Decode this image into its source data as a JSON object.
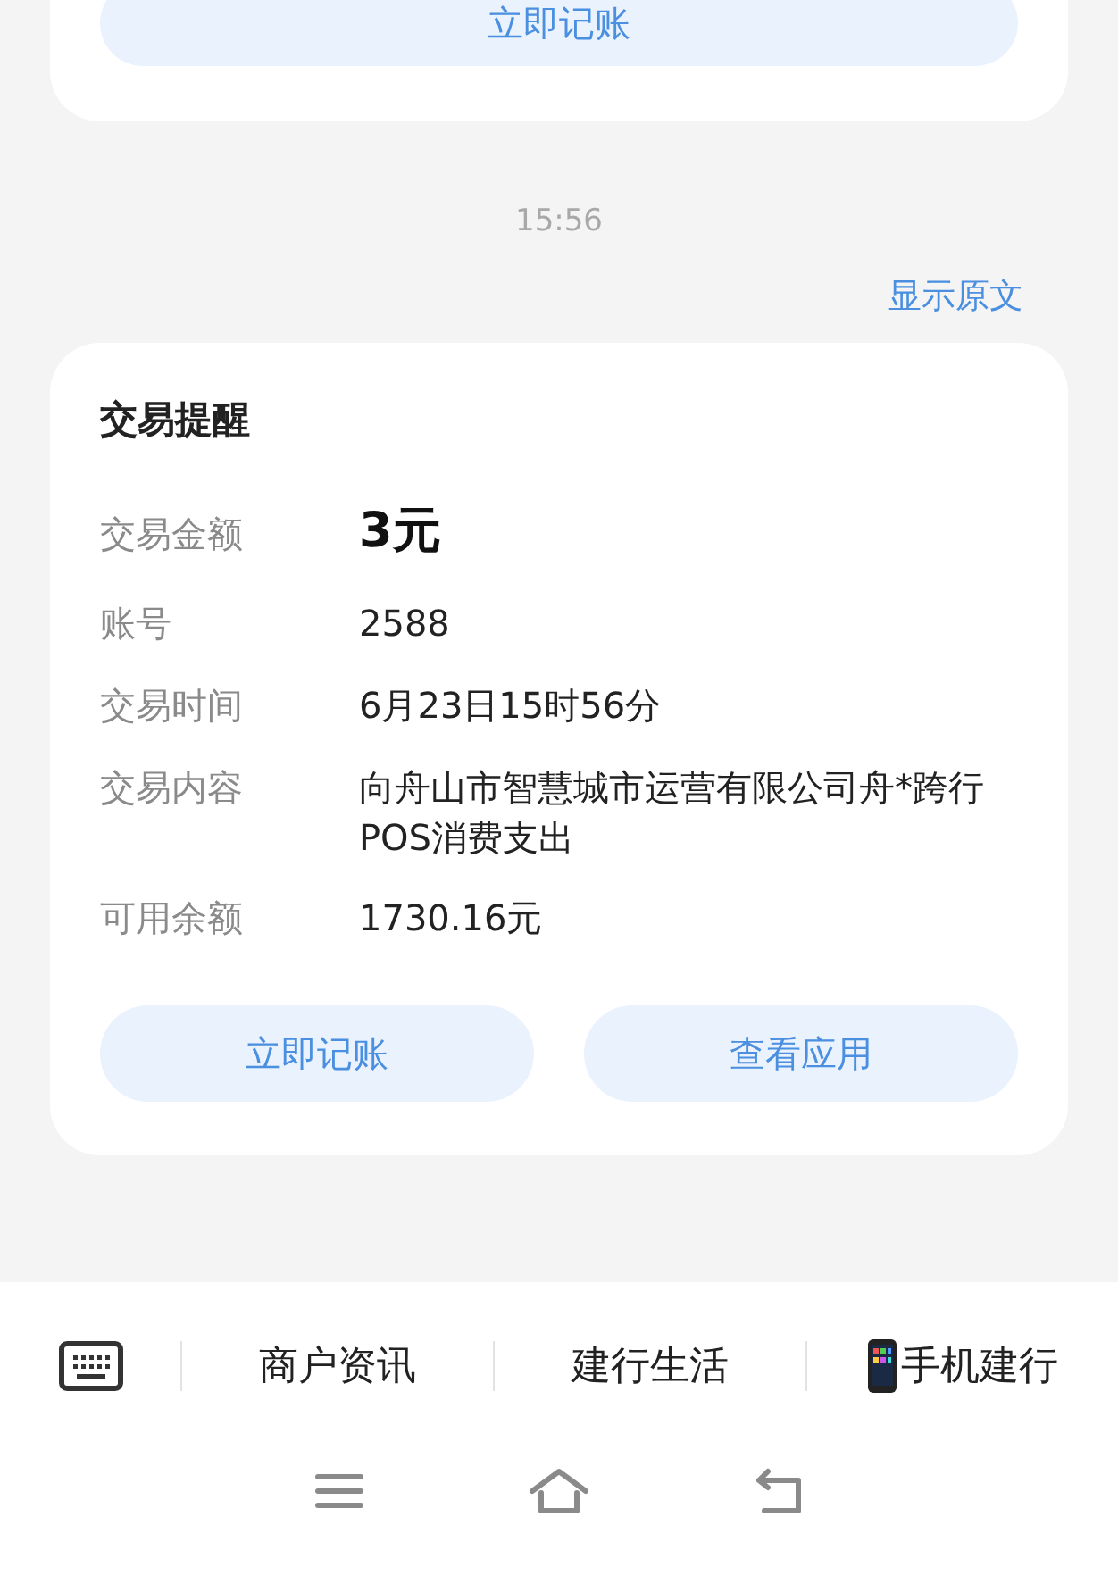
{
  "previous_card": {
    "button": "立即记账"
  },
  "timestamp": "15:56",
  "show_original_link": "显示原文",
  "card": {
    "title": "交易提醒",
    "rows": [
      {
        "label": "交易金额",
        "value": "3元",
        "kind": "amount"
      },
      {
        "label": "账号",
        "value": "2588",
        "kind": "text"
      },
      {
        "label": "交易时间",
        "value": "6月23日15时56分",
        "kind": "text"
      },
      {
        "label": "交易内容",
        "value": "向舟山市智慧城市运营有限公司舟*跨行POS消费支出",
        "kind": "text"
      },
      {
        "label": "可用余额",
        "value": "1730.16元",
        "kind": "text"
      }
    ],
    "buttons": [
      "立即记账",
      "查看应用"
    ]
  },
  "menu_bar": {
    "items": [
      {
        "label": "商户资讯",
        "kind": "text"
      },
      {
        "label": "建行生活",
        "kind": "text"
      },
      {
        "label": "手机建行",
        "kind": "phone"
      }
    ]
  }
}
